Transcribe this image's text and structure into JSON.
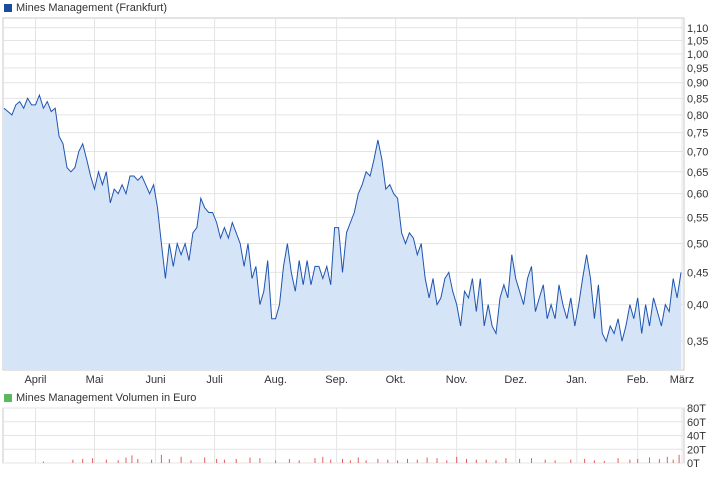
{
  "chart_data": [
    {
      "type": "area",
      "title": "Mines Management (Frankfurt)",
      "legend_color": "#1a4c9a",
      "line_color": "#1f55b0",
      "fill_color": "#d6e4f8",
      "y_scale": "log",
      "ylim": [
        0.315,
        1.14
      ],
      "y_ticks": [
        "0,35",
        "0,40",
        "0,45",
        "0,50",
        "0,55",
        "0,60",
        "0,65",
        "0,70",
        "0,75",
        "0,80",
        "0,85",
        "0,90",
        "0,95",
        "1,00",
        "1,05",
        "1,10"
      ],
      "y_tick_values": [
        0.35,
        0.4,
        0.45,
        0.5,
        0.55,
        0.6,
        0.65,
        0.7,
        0.75,
        0.8,
        0.85,
        0.9,
        0.95,
        1.0,
        1.05,
        1.1
      ],
      "months": [
        "April",
        "Mai",
        "Juni",
        "Juli",
        "Aug.",
        "Sep.",
        "Okt.",
        "Nov.",
        "Dez.",
        "Jan.",
        "Feb.",
        "März"
      ],
      "x_range_days": [
        0,
        345
      ],
      "x_month_start_days": [
        16,
        46,
        77,
        107,
        138,
        169,
        199,
        230,
        260,
        291,
        322,
        350
      ],
      "series": [
        {
          "points": [
            [
              0,
              0.82
            ],
            [
              2,
              0.81
            ],
            [
              4,
              0.8
            ],
            [
              6,
              0.83
            ],
            [
              8,
              0.84
            ],
            [
              10,
              0.82
            ],
            [
              12,
              0.85
            ],
            [
              14,
              0.83
            ],
            [
              16,
              0.83
            ],
            [
              18,
              0.86
            ],
            [
              20,
              0.82
            ],
            [
              22,
              0.84
            ],
            [
              24,
              0.81
            ],
            [
              26,
              0.82
            ],
            [
              28,
              0.74
            ],
            [
              30,
              0.72
            ],
            [
              32,
              0.66
            ],
            [
              34,
              0.65
            ],
            [
              36,
              0.66
            ],
            [
              38,
              0.7
            ],
            [
              40,
              0.72
            ],
            [
              42,
              0.68
            ],
            [
              44,
              0.64
            ],
            [
              46,
              0.61
            ],
            [
              48,
              0.65
            ],
            [
              50,
              0.62
            ],
            [
              52,
              0.65
            ],
            [
              54,
              0.58
            ],
            [
              56,
              0.61
            ],
            [
              58,
              0.6
            ],
            [
              60,
              0.62
            ],
            [
              62,
              0.6
            ],
            [
              64,
              0.64
            ],
            [
              66,
              0.64
            ],
            [
              68,
              0.63
            ],
            [
              70,
              0.64
            ],
            [
              72,
              0.62
            ],
            [
              74,
              0.6
            ],
            [
              76,
              0.62
            ],
            [
              78,
              0.57
            ],
            [
              80,
              0.5
            ],
            [
              82,
              0.44
            ],
            [
              84,
              0.5
            ],
            [
              86,
              0.46
            ],
            [
              88,
              0.5
            ],
            [
              90,
              0.48
            ],
            [
              92,
              0.5
            ],
            [
              94,
              0.47
            ],
            [
              96,
              0.52
            ],
            [
              98,
              0.53
            ],
            [
              100,
              0.59
            ],
            [
              102,
              0.57
            ],
            [
              104,
              0.56
            ],
            [
              106,
              0.56
            ],
            [
              108,
              0.54
            ],
            [
              110,
              0.51
            ],
            [
              112,
              0.53
            ],
            [
              114,
              0.51
            ],
            [
              116,
              0.54
            ],
            [
              118,
              0.52
            ],
            [
              120,
              0.5
            ],
            [
              122,
              0.46
            ],
            [
              124,
              0.5
            ],
            [
              126,
              0.44
            ],
            [
              128,
              0.46
            ],
            [
              130,
              0.4
            ],
            [
              132,
              0.42
            ],
            [
              134,
              0.47
            ],
            [
              136,
              0.38
            ],
            [
              138,
              0.38
            ],
            [
              140,
              0.4
            ],
            [
              142,
              0.46
            ],
            [
              144,
              0.5
            ],
            [
              146,
              0.45
            ],
            [
              148,
              0.42
            ],
            [
              150,
              0.47
            ],
            [
              152,
              0.43
            ],
            [
              154,
              0.47
            ],
            [
              156,
              0.43
            ],
            [
              158,
              0.46
            ],
            [
              160,
              0.46
            ],
            [
              162,
              0.44
            ],
            [
              164,
              0.46
            ],
            [
              166,
              0.43
            ],
            [
              168,
              0.53
            ],
            [
              170,
              0.53
            ],
            [
              172,
              0.45
            ],
            [
              174,
              0.52
            ],
            [
              176,
              0.54
            ],
            [
              178,
              0.56
            ],
            [
              180,
              0.6
            ],
            [
              182,
              0.62
            ],
            [
              184,
              0.65
            ],
            [
              186,
              0.64
            ],
            [
              188,
              0.68
            ],
            [
              190,
              0.73
            ],
            [
              192,
              0.68
            ],
            [
              194,
              0.61
            ],
            [
              196,
              0.62
            ],
            [
              198,
              0.6
            ],
            [
              200,
              0.59
            ],
            [
              202,
              0.52
            ],
            [
              204,
              0.5
            ],
            [
              206,
              0.52
            ],
            [
              208,
              0.51
            ],
            [
              210,
              0.48
            ],
            [
              212,
              0.5
            ],
            [
              214,
              0.44
            ],
            [
              216,
              0.41
            ],
            [
              218,
              0.44
            ],
            [
              220,
              0.4
            ],
            [
              222,
              0.41
            ],
            [
              224,
              0.44
            ],
            [
              226,
              0.45
            ],
            [
              228,
              0.42
            ],
            [
              230,
              0.4
            ],
            [
              232,
              0.37
            ],
            [
              234,
              0.42
            ],
            [
              236,
              0.41
            ],
            [
              238,
              0.44
            ],
            [
              240,
              0.39
            ],
            [
              242,
              0.44
            ],
            [
              244,
              0.37
            ],
            [
              246,
              0.4
            ],
            [
              248,
              0.37
            ],
            [
              250,
              0.36
            ],
            [
              252,
              0.41
            ],
            [
              254,
              0.43
            ],
            [
              256,
              0.41
            ],
            [
              258,
              0.48
            ],
            [
              260,
              0.44
            ],
            [
              262,
              0.42
            ],
            [
              264,
              0.4
            ],
            [
              266,
              0.44
            ],
            [
              268,
              0.46
            ],
            [
              270,
              0.39
            ],
            [
              272,
              0.41
            ],
            [
              274,
              0.43
            ],
            [
              276,
              0.38
            ],
            [
              278,
              0.4
            ],
            [
              280,
              0.38
            ],
            [
              282,
              0.43
            ],
            [
              284,
              0.4
            ],
            [
              286,
              0.38
            ],
            [
              288,
              0.41
            ],
            [
              290,
              0.37
            ],
            [
              292,
              0.4
            ],
            [
              294,
              0.44
            ],
            [
              296,
              0.48
            ],
            [
              298,
              0.44
            ],
            [
              300,
              0.38
            ],
            [
              302,
              0.43
            ],
            [
              304,
              0.36
            ],
            [
              306,
              0.35
            ],
            [
              308,
              0.37
            ],
            [
              310,
              0.36
            ],
            [
              312,
              0.38
            ],
            [
              314,
              0.35
            ],
            [
              316,
              0.37
            ],
            [
              318,
              0.4
            ],
            [
              320,
              0.38
            ],
            [
              322,
              0.41
            ],
            [
              324,
              0.36
            ],
            [
              326,
              0.4
            ],
            [
              328,
              0.37
            ],
            [
              330,
              0.41
            ],
            [
              332,
              0.39
            ],
            [
              334,
              0.37
            ],
            [
              336,
              0.4
            ],
            [
              338,
              0.39
            ],
            [
              340,
              0.44
            ],
            [
              342,
              0.41
            ],
            [
              344,
              0.45
            ]
          ]
        }
      ]
    },
    {
      "type": "bar",
      "title": "Mines Management Volumen in Euro",
      "legend_color": "#5cb85c",
      "bar_color": "#e06060",
      "ylim": [
        0,
        80
      ],
      "y_ticks": [
        "0T",
        "20T",
        "40T",
        "60T",
        "80T"
      ],
      "y_tick_values": [
        0,
        20,
        40,
        60,
        80
      ],
      "series": [
        {
          "values_by_day": [
            [
              20,
              2
            ],
            [
              35,
              5
            ],
            [
              40,
              6
            ],
            [
              45,
              7
            ],
            [
              52,
              5
            ],
            [
              58,
              4
            ],
            [
              62,
              8
            ],
            [
              65,
              11
            ],
            [
              68,
              6
            ],
            [
              75,
              5
            ],
            [
              80,
              12
            ],
            [
              84,
              6
            ],
            [
              90,
              9
            ],
            [
              95,
              4
            ],
            [
              102,
              8
            ],
            [
              108,
              6
            ],
            [
              112,
              5
            ],
            [
              118,
              6
            ],
            [
              125,
              8
            ],
            [
              130,
              7
            ],
            [
              138,
              4
            ],
            [
              145,
              6
            ],
            [
              150,
              4
            ],
            [
              158,
              7
            ],
            [
              162,
              9
            ],
            [
              166,
              5
            ],
            [
              172,
              6
            ],
            [
              176,
              4
            ],
            [
              180,
              8
            ],
            [
              184,
              4
            ],
            [
              190,
              6
            ],
            [
              195,
              5
            ],
            [
              200,
              4
            ],
            [
              205,
              6
            ],
            [
              210,
              5
            ],
            [
              215,
              8
            ],
            [
              220,
              7
            ],
            [
              225,
              4
            ],
            [
              230,
              9
            ],
            [
              235,
              6
            ],
            [
              240,
              5
            ],
            [
              245,
              5
            ],
            [
              250,
              4
            ],
            [
              255,
              7
            ],
            [
              262,
              6
            ],
            [
              268,
              7
            ],
            [
              275,
              5
            ],
            [
              280,
              4
            ],
            [
              288,
              5
            ],
            [
              295,
              6
            ],
            [
              300,
              4
            ],
            [
              305,
              3
            ],
            [
              312,
              7
            ],
            [
              318,
              5
            ],
            [
              322,
              6
            ],
            [
              328,
              8
            ],
            [
              333,
              6
            ],
            [
              337,
              9
            ],
            [
              340,
              5
            ],
            [
              343,
              12
            ]
          ]
        }
      ]
    }
  ]
}
